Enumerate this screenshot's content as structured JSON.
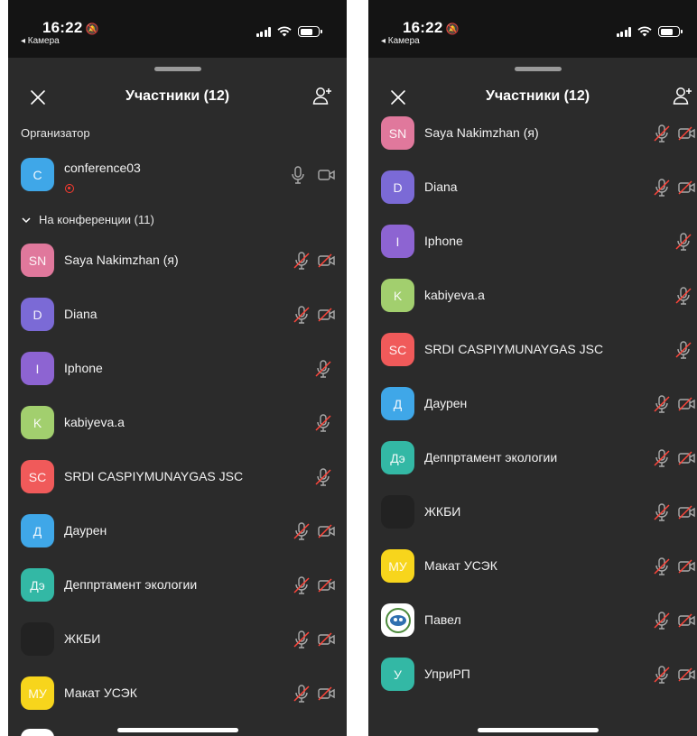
{
  "status": {
    "time": "16:22",
    "back_label": "◂ Камера"
  },
  "header": {
    "title": "Участники (12)"
  },
  "left": {
    "organizer_label": "Организатор",
    "organizer": {
      "initial": "C",
      "name": "conference03",
      "color": "#3fa7e8"
    },
    "conference_label": "На конференции (11)",
    "participants": [
      {
        "initials": "SN",
        "name": "Saya Nakimzhan (я)",
        "color": "#e0789c",
        "video": true
      },
      {
        "initials": "D",
        "name": "Diana",
        "color": "#7b6ad6",
        "video": true
      },
      {
        "initials": "I",
        "name": "Iphone",
        "color": "#8d64d2",
        "video": false
      },
      {
        "initials": "K",
        "name": "kabiyeva.a",
        "color": "#a2cf6e",
        "video": false
      },
      {
        "initials": "SC",
        "name": "SRDI CASPIYMUNAYGAS JSC",
        "color": "#f05a5a",
        "video": false
      },
      {
        "initials": "Д",
        "name": "Даурен",
        "color": "#3fa7e8",
        "video": true
      },
      {
        "initials": "Дэ",
        "name": "Деппртамент экологии",
        "color": "#33b8a5",
        "video": true
      },
      {
        "initials": "",
        "name": "ЖКБИ",
        "color": "#222222",
        "video": true
      },
      {
        "initials": "МУ",
        "name": "Макат УСЭК",
        "color": "#f7d51c",
        "video": true
      }
    ]
  },
  "right": {
    "participants": [
      {
        "initials": "SN",
        "name": "Saya Nakimzhan (я)",
        "color": "#e0789c",
        "video": true
      },
      {
        "initials": "D",
        "name": "Diana",
        "color": "#7b6ad6",
        "video": true
      },
      {
        "initials": "I",
        "name": "Iphone",
        "color": "#8d64d2",
        "video": false
      },
      {
        "initials": "K",
        "name": "kabiyeva.a",
        "color": "#a2cf6e",
        "video": false
      },
      {
        "initials": "SC",
        "name": "SRDI CASPIYMUNAYGAS JSC",
        "color": "#f05a5a",
        "video": false
      },
      {
        "initials": "Д",
        "name": "Даурен",
        "color": "#3fa7e8",
        "video": true
      },
      {
        "initials": "Дэ",
        "name": "Деппртамент экологии",
        "color": "#33b8a5",
        "video": true
      },
      {
        "initials": "",
        "name": "ЖКБИ",
        "color": "#222222",
        "video": true
      },
      {
        "initials": "МУ",
        "name": "Макат УСЭК",
        "color": "#f7d51c",
        "video": true
      },
      {
        "initials": "",
        "name": "Павел",
        "color": "#ffffff",
        "video": true,
        "logo": true
      },
      {
        "initials": "У",
        "name": "УприРП",
        "color": "#33b8a5",
        "video": true
      }
    ]
  }
}
